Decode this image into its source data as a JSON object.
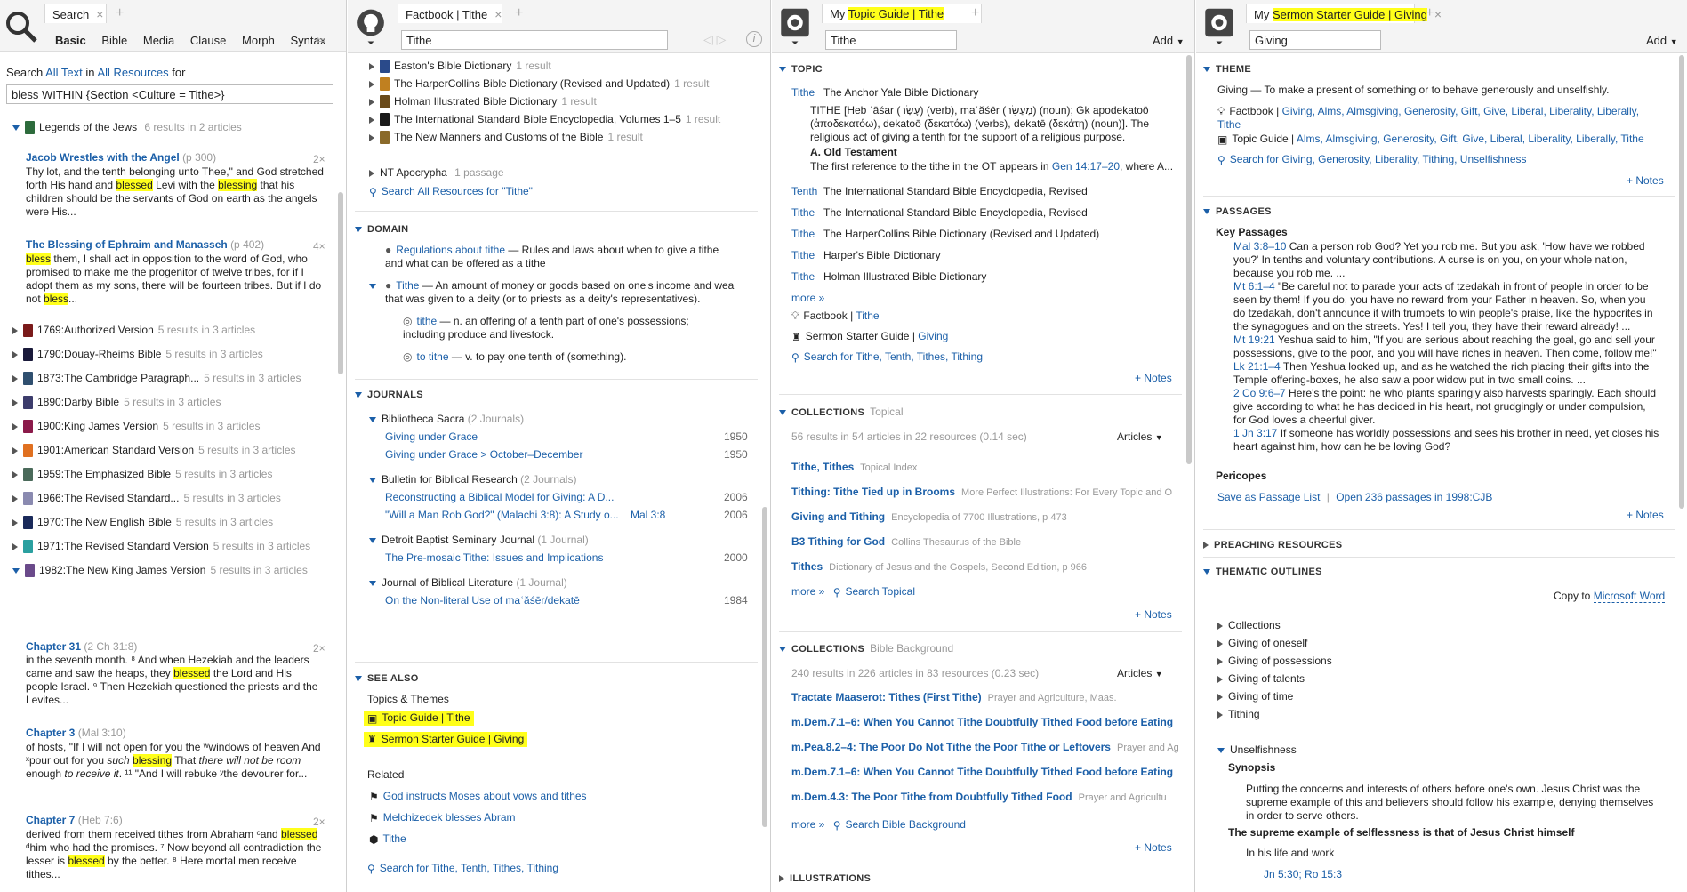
{
  "search_panel": {
    "tab": "Search",
    "tabs": [
      "Basic",
      "Bible",
      "Media",
      "Clause",
      "Morph",
      "Syntax"
    ],
    "query_prefix": "Search",
    "query_scope1": "All Text",
    "query_in": "in",
    "query_scope2": "All Resources",
    "query_for": "for",
    "query": "bless WITHIN {Section <Culture = Tithe>}",
    "groups": [
      {
        "title": "Legends of the Jews",
        "count": "6 results in 2 articles",
        "color": "#2d6b3c"
      },
      {
        "title": "1769:Authorized Version",
        "count": "5 results in 3 articles",
        "color": "#7a1a1a"
      },
      {
        "title": "1790:Douay-Rheims Bible",
        "count": "5 results in 3 articles",
        "color": "#1a1a3a"
      },
      {
        "title": "1873:The Cambridge Paragraph...",
        "count": "5 results in 3 articles",
        "color": "#2f4f6f"
      },
      {
        "title": "1890:Darby Bible",
        "count": "5 results in 3 articles",
        "color": "#3c3c6c"
      },
      {
        "title": "1900:King James Version",
        "count": "5 results in 3 articles",
        "color": "#8b1a4a"
      },
      {
        "title": "1901:American Standard Version",
        "count": "5 results in 3 articles",
        "color": "#e07020"
      },
      {
        "title": "1959:The Emphasized Bible",
        "count": "5 results in 3 articles",
        "color": "#4a6a5a"
      },
      {
        "title": "1966:The Revised Standard...",
        "count": "5 results in 3 articles",
        "color": "#8a8ab0"
      },
      {
        "title": "1970:The New English Bible",
        "count": "5 results in 3 articles",
        "color": "#1a2a5a"
      },
      {
        "title": "1971:The Revised Standard Version",
        "count": "5 results in 3 articles",
        "color": "#2aa0a0"
      },
      {
        "title": "1982:The New King James Version",
        "count": "5 results in 3 articles",
        "color": "#6a4a8a"
      }
    ],
    "hit1_title": "Jacob Wrestles with the Angel",
    "hit1_page": "(p 300)",
    "hit1_count": "2×",
    "hit1_text_a": "Thy lot, and the tenth belonging unto Thee,\" and God stretched forth His hand and ",
    "hit1_hl1": "blessed",
    "hit1_text_b": " Levi with the ",
    "hit1_hl2": "blessing",
    "hit1_text_c": " that his children should be the servants of God on earth as the angels were His...",
    "hit2_title": "The Blessing of Ephraim and Manasseh",
    "hit2_page": "(p 402)",
    "hit2_count": "4×",
    "hit2_hl1": "bless",
    "hit2_text_a": " them, I shall act in opposition to the word of God, who promised to make me the progenitor of twelve tribes, for if I adopt them as my sons, there will be fourteen tribes. But if I do not ",
    "hit2_hl2": "bless",
    "hit2_text_b": "...",
    "hit3_title": "Chapter 31",
    "hit3_ref": "(2 Ch 31:8)",
    "hit3_count": "2×",
    "hit3_text_a": "in the seventh month. ⁸ And when Hezekiah and the leaders came and saw the heaps, they ",
    "hit3_hl": "blessed",
    "hit3_text_b": " the Lord and His people Israel. ⁹ Then Hezekiah questioned the priests and the Levites...",
    "hit4_title": "Chapter 3",
    "hit4_ref": "(Mal 3:10)",
    "hit4_text_a": "of hosts, \"If I will not open for you the ʷwindows of heaven And ˣpour out for you ",
    "hit4_it1": "such",
    "hit4_hl": "blessing",
    "hit4_text_b": " That ",
    "hit4_it2": "there will not be room",
    "hit4_text_c": " enough ",
    "hit4_it3": "to receive it",
    "hit4_text_d": ". ¹¹ \"And I will rebuke ʸthe devourer for...",
    "hit5_title": "Chapter 7",
    "hit5_ref": "(Heb 7:6)",
    "hit5_count": "2×",
    "hit5_text_a": "derived from them received tithes from Abraham ᶜand ",
    "hit5_hl1": "blessed",
    "hit5_text_b": " ᵈhim who had the promises. ⁷ Now beyond all contradiction the lesser is ",
    "hit5_hl2": "blessed",
    "hit5_text_c": " by the better. ⁸ Here mortal men receive tithes..."
  },
  "factbook_panel": {
    "tab": "Factbook | Tithe",
    "query": "Tithe",
    "resources": [
      {
        "title": "Easton's Bible Dictionary",
        "count": "1 result",
        "color": "#2a4a8a"
      },
      {
        "title": "The HarperCollins Bible Dictionary (Revised and Updated)",
        "count": "1 result",
        "color": "#c08020"
      },
      {
        "title": "Holman Illustrated Bible Dictionary",
        "count": "1 result",
        "color": "#6a4a1a"
      },
      {
        "title": "The International Standard Bible Encyclopedia, Volumes 1–5",
        "count": "1 result",
        "color": "#1a1a1a"
      },
      {
        "title": "The New Manners and Customs of the Bible",
        "count": "1 result",
        "color": "#8a6a2a"
      }
    ],
    "apocrypha": "NT Apocrypha",
    "apocrypha_count": "1 passage",
    "search_all": "Search All Resources for \"Tithe\"",
    "domain_h": "DOMAIN",
    "domain1_link": "Regulations about tithe",
    "domain1_text": " — Rules and laws about when to give a tithe and what can be offered as a tithe",
    "domain2_link": "Tithe",
    "domain2_text": " — An amount of money or goods based on one's income and wea that was given to a deity (or to priests as a deity's representatives).",
    "sense1_link": "tithe",
    "sense1_text": " — n. an offering of a tenth part of one's possessions; including produce and livestock.",
    "sense2_link": "to tithe",
    "sense2_text": " — v. to pay one tenth of (something).",
    "journals_h": "JOURNALS",
    "journals": [
      {
        "name": "Bibliotheca Sacra",
        "count": "(2 Journals)",
        "items": [
          {
            "title": "Giving under Grace",
            "date": "1950"
          },
          {
            "title": "Giving under Grace > October–December",
            "date": "1950"
          }
        ]
      },
      {
        "name": "Bulletin for Biblical Research",
        "count": "(2 Journals)",
        "items": [
          {
            "title": "Reconstructing a Biblical Model for Giving: A D...",
            "date": "2006"
          },
          {
            "title": "\"Will a Man Rob God?\" (Malachi 3:8): A Study o...",
            "ref": "Mal 3:8",
            "date": "2006"
          }
        ]
      },
      {
        "name": "Detroit Baptist Seminary Journal",
        "count": "(1 Journal)",
        "items": [
          {
            "title": "The Pre-mosaic Tithe: Issues and Implications",
            "date": "2000"
          }
        ]
      },
      {
        "name": "Journal of Biblical Literature",
        "count": "(1 Journal)",
        "items": [
          {
            "title": "On the Non-literal Use of maʿăśēr/dekatē",
            "date": "1984"
          }
        ]
      }
    ],
    "seealso_h": "SEE ALSO",
    "topics_h": "Topics & Themes",
    "topic_guide": "Topic Guide | Tithe",
    "sermon_guide": "Sermon Starter Guide | Giving",
    "related_h": "Related",
    "related": [
      "God instructs Moses about vows and tithes",
      "Melchizedek blesses Abram",
      "Tithe"
    ],
    "search_for": "Search for Tithe, Tenth, Tithes, Tithing"
  },
  "topic_panel": {
    "tab_prefix": "My ",
    "tab": "Topic Guide | Tithe",
    "query": "Tithe",
    "add": "Add",
    "topic_h": "TOPIC",
    "entry1_head": "Tithe",
    "entry1_source": "The Anchor Yale Bible Dictionary",
    "entry1_text": "TITHE [Heb ʿāśar (עָשַׂר) (verb), maʿăśēr (מַעֲשֵׂר) (noun); Gk apodekatoō (ἀποδεκατόω), dekatoō (δεκατόω) (verbs), dekatē (δεκάτη) (noun)]. The religious act of giving a tenth for the support of a religious purpose.",
    "entry1_sub": "A. Old Testament",
    "entry1_more_a": "The first reference to the tithe in the OT appears in ",
    "entry1_ref": "Gen 14:17–20",
    "entry1_more_b": ", where A...",
    "entries": [
      {
        "head": "Tenth",
        "source": "The International Standard Bible Encyclopedia, Revised"
      },
      {
        "head": "Tithe",
        "source": "The International Standard Bible Encyclopedia, Revised"
      },
      {
        "head": "Tithe",
        "source": "The HarperCollins Bible Dictionary (Revised and Updated)"
      },
      {
        "head": "Tithe",
        "source": "Harper's Bible Dictionary"
      },
      {
        "head": "Tithe",
        "source": "Holman Illustrated Bible Dictionary"
      }
    ],
    "more": "more »",
    "factbook_label": "Factbook | ",
    "factbook_link": "Tithe",
    "sermon_label": "Sermon Starter Guide | ",
    "sermon_link": "Giving",
    "search_for": "Search for Tithe, Tenth, Tithes, Tithing",
    "notes": "+ Notes",
    "coll1_h": "COLLECTIONS",
    "coll1_sub": "Topical",
    "coll1_stats": "56 results in 54 articles in 22 resources (0.14 sec)",
    "articles": "Articles",
    "coll1_items": [
      {
        "title": "Tithe, Tithes",
        "source": "Topical Index"
      },
      {
        "title": "Tithing: Tithe Tied up in Brooms",
        "source": "More Perfect Illustrations: For Every Topic and O"
      },
      {
        "title": "Giving and Tithing",
        "source": "Encyclopedia of 7700 Illustrations, p 473"
      },
      {
        "title": "B3 Tithing for God",
        "source": "Collins Thesaurus of the Bible"
      },
      {
        "title": "Tithes",
        "source": "Dictionary of Jesus and the Gospels, Second Edition, p 966"
      }
    ],
    "coll1_search": "Search Topical",
    "coll2_h": "COLLECTIONS",
    "coll2_sub": "Bible Background",
    "coll2_stats": "240 results in 226 articles in 83 resources (0.23 sec)",
    "coll2_items": [
      {
        "title": "Tractate Maaserot: Tithes (First Tithe)",
        "source": "Prayer and Agriculture, Maas."
      },
      {
        "title": "m.Dem.7.1–6: When You Cannot Tithe Doubtfully Tithed Food before Eating",
        "source": ""
      },
      {
        "title": "m.Pea.8.2–4: The Poor Do Not Tithe the Poor Tithe or Leftovers",
        "source": "Prayer and Ag"
      },
      {
        "title": "m.Dem.7.1–6: When You Cannot Tithe Doubtfully Tithed Food before Eating",
        "source": ""
      },
      {
        "title": "m.Dem.4.3: The Poor Tithe from Doubtfully Tithed Food",
        "source": "Prayer and Agricultu"
      }
    ],
    "coll2_search": "Search Bible Background",
    "illus_h": "ILLUSTRATIONS"
  },
  "sermon_panel": {
    "tab_prefix": "My ",
    "tab": "Sermon Starter Guide | Giving",
    "query": "Giving",
    "add": "Add",
    "theme_h": "THEME",
    "theme_def": "Giving — To make a present of something or to behave generously and unselfishly.",
    "factbook_label": "Factbook | ",
    "factbook_links": "Giving, Alms, Almsgiving, Generosity, Gift, Give, Liberal, Liberality, Liberally, Tithe",
    "topic_label": "Topic Guide | ",
    "topic_links": "Alms, Almsgiving, Generosity, Gift, Give, Liberal, Liberality, Liberally, Tithe",
    "search_for": "Search for Giving, Generosity, Liberality, Tithing, Unselfishness",
    "notes": "+ Notes",
    "passages_h": "PASSAGES",
    "key_h": "Key Passages",
    "passages": [
      {
        "ref": "Mal 3:8–10",
        "text": "Can a person rob God? Yet you rob me. But you ask, 'How have we robbed you?' In tenths and voluntary contributions. A curse is on you, on your whole nation, because you rob me. ..."
      },
      {
        "ref": "Mt 6:1–4",
        "text": "\"Be careful not to parade your acts of tzedakah in front of people in order to be seen by them! If you do, you have no reward from your Father in heaven. So, when you do tzedakah, don't announce it with trumpets to win people's praise, like the hypocrites in the synagogues and on the streets. Yes! I tell you, they have their reward already! ..."
      },
      {
        "ref": "Mt 19:21",
        "text": "Yeshua said to him, \"If you are serious about reaching the goal, go and sell your possessions, give to the poor, and you will have riches in heaven. Then come, follow me!\""
      },
      {
        "ref": "Lk 21:1–4",
        "text": "Then Yeshua looked up, and as he watched the rich placing their gifts into the Temple offering-boxes, he also saw a poor widow put in two small coins. ..."
      },
      {
        "ref": "2 Co 9:6–7",
        "text": "Here's the point: he who plants sparingly also harvests sparingly. Each should give according to what he has decided in his heart, not grudgingly or under compulsion, for God loves a cheerful giver."
      },
      {
        "ref": "1 Jn 3:17",
        "text": "If someone has worldly possessions and sees his brother in need, yet closes his heart against him, how can he be loving God?"
      }
    ],
    "pericopes_h": "Pericopes",
    "save_list": "Save as Passage List",
    "open_passages": "Open 236 passages in 1998:CJB",
    "preaching_h": "PREACHING RESOURCES",
    "outlines_h": "THEMATIC OUTLINES",
    "copy_to": "Copy to ",
    "copy_target": "Microsoft Word",
    "outline_items": [
      "Collections",
      "Giving of oneself",
      "Giving of possessions",
      "Giving of talents",
      "Giving of time",
      "Tithing"
    ],
    "unselfishness": "Unselfishness",
    "synopsis_h": "Synopsis",
    "synopsis": "Putting the concerns and interests of others before one's own. Jesus Christ was the supreme example of this and believers should follow his example, denying themselves in order to serve others.",
    "supreme_h": "The supreme example of selflessness is that of Jesus Christ himself",
    "life_h": "In his life and work",
    "life_refs": "Jn 5:30; Ro 15:3"
  }
}
